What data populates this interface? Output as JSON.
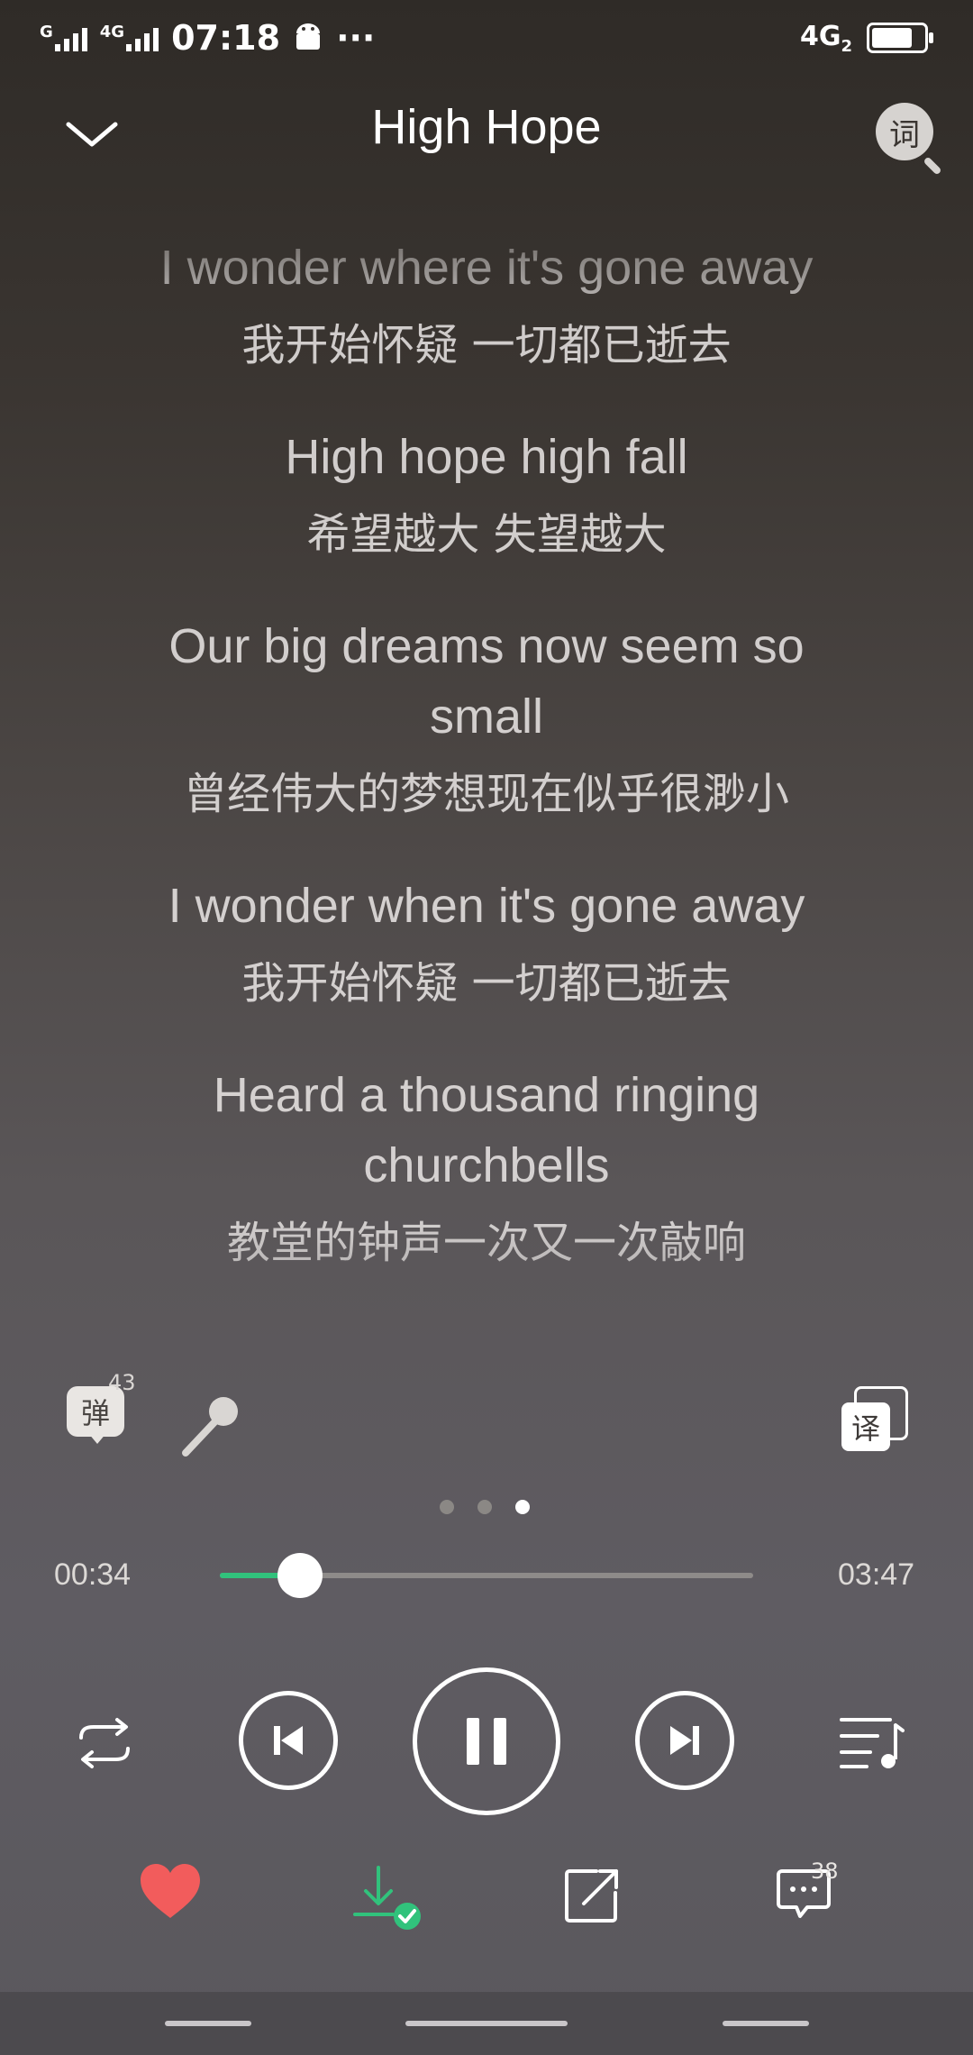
{
  "status_bar": {
    "left_net1": "G",
    "left_net2": "4G",
    "time": "07:18",
    "more": "···",
    "right_net": "4G",
    "right_sim": "2",
    "battery_level": 0.8
  },
  "header": {
    "title": "High Hope",
    "lyric_search_glyph": "词"
  },
  "lyrics": [
    {
      "en": "I wonder where it's gone away",
      "zh": "我开始怀疑 一切都已逝去"
    },
    {
      "en": "High hope high fall",
      "zh": "希望越大 失望越大"
    },
    {
      "en": "Our big dreams now seem so small",
      "zh": "曾经伟大的梦想现在似乎很渺小"
    },
    {
      "en": "I wonder when it's gone away",
      "zh": "我开始怀疑 一切都已逝去"
    },
    {
      "en": "Heard a thousand ringing churchbells",
      "zh": "教堂的钟声一次又一次敲响"
    }
  ],
  "tools": {
    "danmu_glyph": "弹",
    "danmu_count": "43",
    "translate_glyph": "译"
  },
  "pager": {
    "count": 3,
    "active": 3
  },
  "progress": {
    "elapsed": "00:34",
    "total": "03:47",
    "fraction": 0.15
  },
  "actions": {
    "comment_count": "38"
  },
  "colors": {
    "accent_green": "#31c27c",
    "heart_red": "#f25c5c"
  },
  "icons": [
    "chevron-down-icon",
    "lyric-search-icon",
    "danmu-icon",
    "microphone-icon",
    "translate-icon",
    "repeat-icon",
    "previous-icon",
    "pause-icon",
    "next-icon",
    "playlist-icon",
    "heart-icon",
    "download-icon",
    "share-icon",
    "comment-icon"
  ]
}
